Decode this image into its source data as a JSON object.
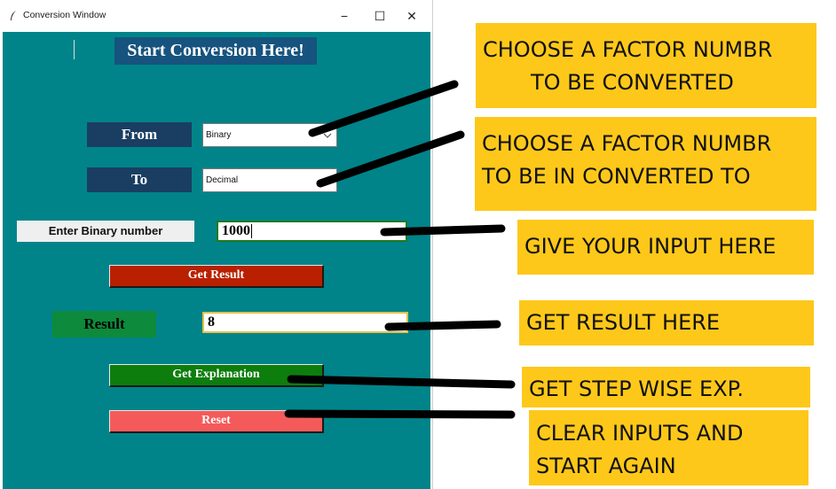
{
  "window": {
    "title": "Conversion Window",
    "controls": {
      "minimize": "−",
      "maximize": "☐",
      "close": "✕"
    }
  },
  "form": {
    "heading": "Start Conversion Here!",
    "from_label": "From",
    "from_value": "Binary",
    "to_label": "To",
    "to_value": "Decimal",
    "input_label": "Enter Binary number",
    "input_value": "1000",
    "get_result_label": "Get Result",
    "result_label": "Result",
    "result_value": "8",
    "get_explanation_label": "Get Explanation",
    "reset_label": "Reset"
  },
  "callouts": {
    "choose_from": [
      "CHOOSE A FACTOR NUMBR",
      "TO BE CONVERTED"
    ],
    "choose_to": [
      "CHOOSE A FACTOR NUMBR",
      "TO BE IN CONVERTED TO"
    ],
    "input_hint": "GIVE YOUR INPUT HERE",
    "result_hint": "GET RESULT HERE",
    "explain_hint": "GET STEP WISE EXP.",
    "reset_hint": [
      "CLEAR INPUTS AND",
      "START AGAIN"
    ]
  },
  "colors": {
    "client_bg": "#008489",
    "heading_bg": "#16537e",
    "label_bg": "#1a3e62",
    "get_result_bg": "#b82000",
    "result_tag_bg": "#0d8a3c",
    "explain_bg": "#0d7d0d",
    "reset_bg": "#f45a5a",
    "callout_bg": "#fec81a"
  },
  "icons": {
    "app": "feather-icon",
    "dropdown": "chevron-down-icon"
  }
}
